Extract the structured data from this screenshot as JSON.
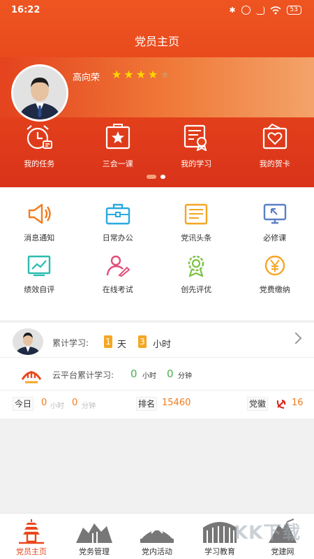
{
  "status_bar": {
    "time": "16:22",
    "battery": "53"
  },
  "header": {
    "title": "党员主页"
  },
  "profile": {
    "name": "高向荣",
    "stars_filled": 4,
    "stars_total": 5
  },
  "quick_links": [
    {
      "label": "我的任务",
      "icon": "alarm-clock-icon"
    },
    {
      "label": "三会一课",
      "icon": "star-board-icon"
    },
    {
      "label": "我的学习",
      "icon": "study-certificate-icon"
    },
    {
      "label": "我的贺卡",
      "icon": "greeting-card-icon"
    }
  ],
  "carousel": {
    "pages": 2,
    "active": 1
  },
  "grid": [
    {
      "label": "消息通知",
      "icon": "speaker-icon",
      "color": "#f37b1d"
    },
    {
      "label": "日常办公",
      "icon": "briefcase-icon",
      "color": "#29a9e0"
    },
    {
      "label": "党讯头条",
      "icon": "news-icon",
      "color": "#f5a623"
    },
    {
      "label": "必修课",
      "icon": "screen-icon",
      "color": "#5b7fc7"
    },
    {
      "label": "绩效自评",
      "icon": "chart-icon",
      "color": "#2bbcb0"
    },
    {
      "label": "在线考试",
      "icon": "person-pen-icon",
      "color": "#e0507a"
    },
    {
      "label": "创先评优",
      "icon": "medal-icon",
      "color": "#7cc242"
    },
    {
      "label": "党费缴纳",
      "icon": "yen-coin-icon",
      "color": "#f5a623"
    }
  ],
  "stats": {
    "cumulative_label": "累计学习:",
    "days": "1",
    "days_unit": "天",
    "hours": "3",
    "hours_unit": "小时",
    "cloud_label": "云平台累计学习:",
    "cloud_hours": "0",
    "cloud_hours_unit": "小时",
    "cloud_minutes": "0",
    "cloud_minutes_unit": "分钟",
    "today_label": "今日",
    "today_hours": "0",
    "today_hours_unit": "小时",
    "today_minutes": "0",
    "today_minutes_unit": "分钟",
    "rank_label": "排名",
    "rank_value": "15460",
    "emblem_label": "党徽",
    "emblem_value": "16"
  },
  "tabbar": [
    {
      "label": "党员主页",
      "icon": "pagoda-icon",
      "active": true
    },
    {
      "label": "党务管理",
      "icon": "monument-icon",
      "active": false
    },
    {
      "label": "党内活动",
      "icon": "statue-icon",
      "active": false
    },
    {
      "label": "学习教育",
      "icon": "building-icon",
      "active": false
    },
    {
      "label": "党建网",
      "icon": "crane-icon",
      "active": false
    }
  ],
  "watermark": "KK下载",
  "colors": {
    "primary": "#e8471c",
    "accent": "#f5a623",
    "green": "#4caf50"
  }
}
